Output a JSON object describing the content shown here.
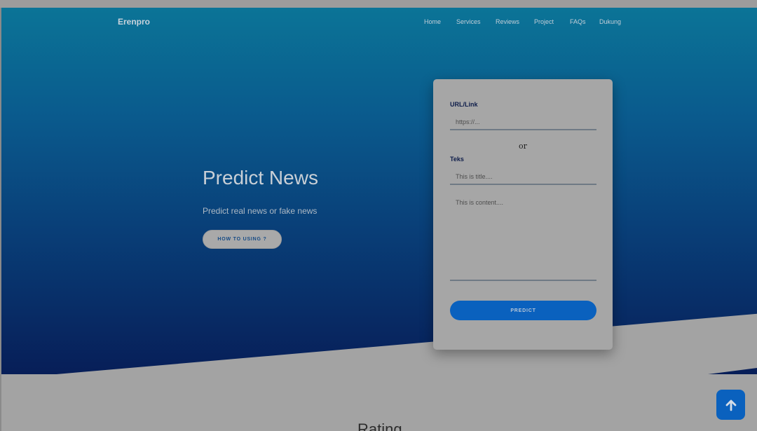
{
  "header": {
    "brand": "Erenpro",
    "nav": [
      {
        "label": "Home"
      },
      {
        "label": "Services"
      },
      {
        "label": "Reviews"
      },
      {
        "label": "Project"
      },
      {
        "label": "FAQs"
      },
      {
        "label": "Dukung"
      }
    ]
  },
  "hero": {
    "title": "Predict News",
    "subtitle": "Predict real news or fake news",
    "cta_label": "HOW TO USING ?"
  },
  "form": {
    "url_label": "URL/Link",
    "url_placeholder": "https://...",
    "or_text": "or",
    "text_label": "Teks",
    "title_placeholder": "This is title....",
    "content_placeholder": "This is content....",
    "predict_label": "PREDICT"
  },
  "section": {
    "rating_heading": "Rating"
  },
  "scroll_top": {
    "icon": "arrow-up-icon"
  },
  "colors": {
    "hero_top": "#0b7497",
    "hero_bottom": "#071e58",
    "accent": "#0a61be"
  }
}
